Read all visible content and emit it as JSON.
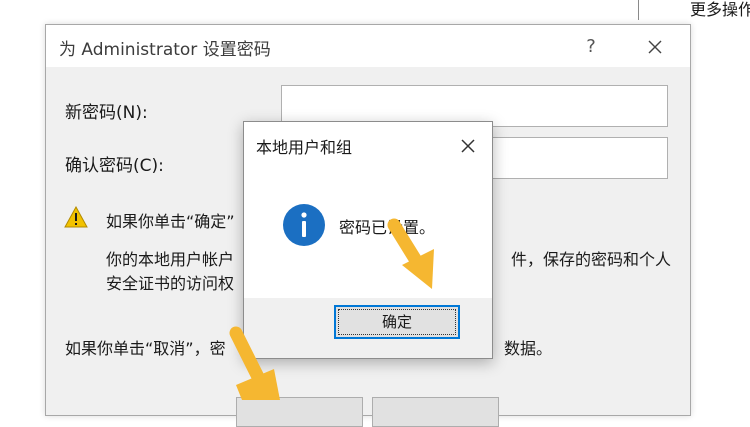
{
  "background": {
    "side_text": "更多操作"
  },
  "main_dialog": {
    "title": "为 Administrator 设置密码",
    "help_symbol": "?",
    "new_password_label": "新密码(N):",
    "confirm_password_label": "确认密码(C):",
    "new_password_value": "",
    "confirm_password_value": "",
    "warning_line1": "如果你单击“确定”",
    "warning_line2_left": "你的本地用户帐户",
    "warning_line2_right": "件，保存的密码和个人",
    "warning_line3": "安全证书的访问权",
    "cancel_line_left": "如果你单击“取消”，密",
    "cancel_line_right": "数据。"
  },
  "info_dialog": {
    "title": "本地用户和组",
    "message": "密码已设置。",
    "ok_label": "确定"
  },
  "colors": {
    "accent": "#0078d7",
    "info_icon": "#1b6fc2",
    "warning_icon": "#f2c200",
    "annotation_arrow": "#f5b731"
  }
}
